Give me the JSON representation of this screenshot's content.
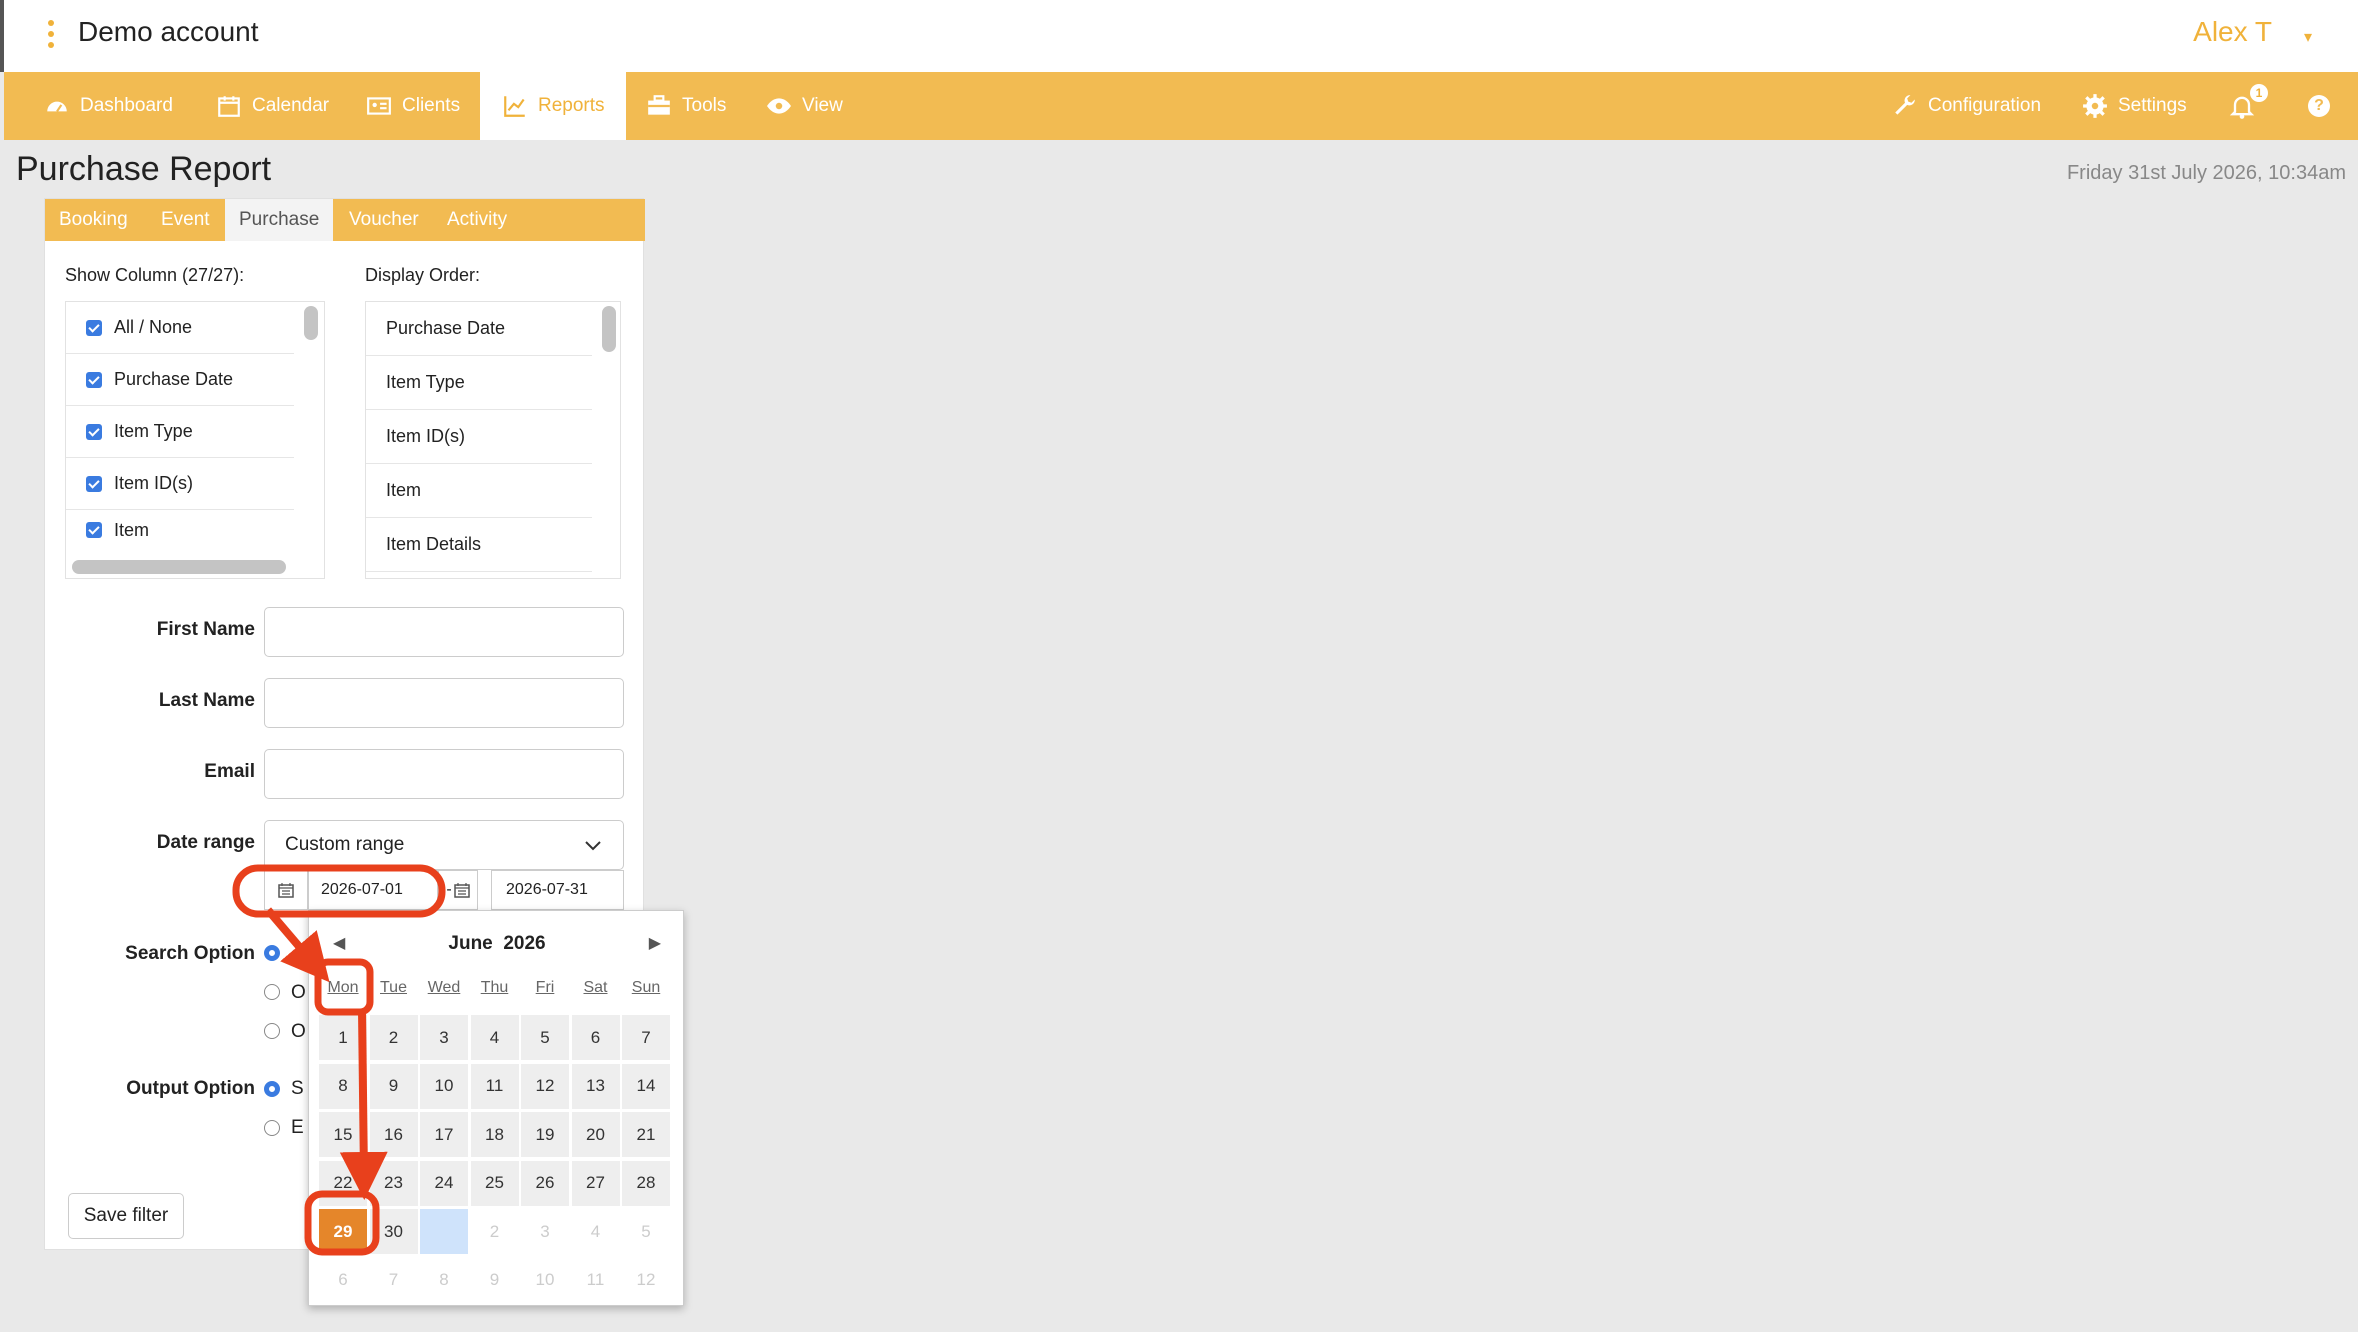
{
  "topbar": {
    "account": "Demo account",
    "user": "Alex T",
    "user_caret": "▾"
  },
  "nav": {
    "items": [
      {
        "label": "Dashboard",
        "icon": "dashboard-icon"
      },
      {
        "label": "Calendar",
        "icon": "calendar-icon"
      },
      {
        "label": "Clients",
        "icon": "clients-icon"
      },
      {
        "label": "Reports",
        "icon": "chart-icon",
        "active": true
      },
      {
        "label": "Tools",
        "icon": "toolbox-icon"
      },
      {
        "label": "View",
        "icon": "eye-icon"
      }
    ],
    "right": [
      {
        "label": "Configuration",
        "icon": "wrench-icon"
      },
      {
        "label": "Settings",
        "icon": "gear-icon"
      }
    ],
    "notifications_count": "1",
    "help": "?"
  },
  "page": {
    "title": "Purchase Report",
    "datetime": "Friday 31st July 2026, 10:34am"
  },
  "subtabs": [
    "Booking",
    "Event",
    "Purchase",
    "Voucher",
    "Activity"
  ],
  "columns": {
    "show_label": "Show Column (27/27):",
    "order_label": "Display Order:",
    "show_items": [
      "All / None",
      "Purchase Date",
      "Item Type",
      "Item ID(s)",
      "Item"
    ],
    "order_items": [
      "Purchase Date",
      "Item Type",
      "Item ID(s)",
      "Item",
      "Item Details"
    ]
  },
  "form": {
    "first_name": "First Name",
    "last_name": "Last Name",
    "email": "Email",
    "date_range": "Date range",
    "date_range_value": "Custom range",
    "date_from": "2026-07-01",
    "date_sep": "-",
    "date_to": "2026-07-31",
    "search_option": "Search Option",
    "search_opt_2": "O",
    "search_opt_3": "O",
    "output_option": "Output Option",
    "output_opt_1": "S",
    "output_opt_2": "E",
    "save_filter": "Save filter"
  },
  "calendar": {
    "month": "June",
    "year": "2026",
    "prev": "◀",
    "next": "▶",
    "weekdays": [
      "Mon",
      "Tue",
      "Wed",
      "Thu",
      "Fri",
      "Sat",
      "Sun"
    ],
    "weeks": [
      [
        "1",
        "2",
        "3",
        "4",
        "5",
        "6",
        "7"
      ],
      [
        "8",
        "9",
        "10",
        "11",
        "12",
        "13",
        "14"
      ],
      [
        "15",
        "16",
        "17",
        "18",
        "19",
        "20",
        "21"
      ],
      [
        "22",
        "23",
        "24",
        "25",
        "26",
        "27",
        "28"
      ],
      [
        "29",
        "30",
        "",
        "2",
        "3",
        "4",
        "5"
      ],
      [
        "6",
        "7",
        "8",
        "9",
        "10",
        "11",
        "12"
      ]
    ],
    "selected": "29"
  },
  "colors": {
    "accent": "#f2bb52",
    "annotation": "#e8401c",
    "selected": "#e5862a"
  }
}
